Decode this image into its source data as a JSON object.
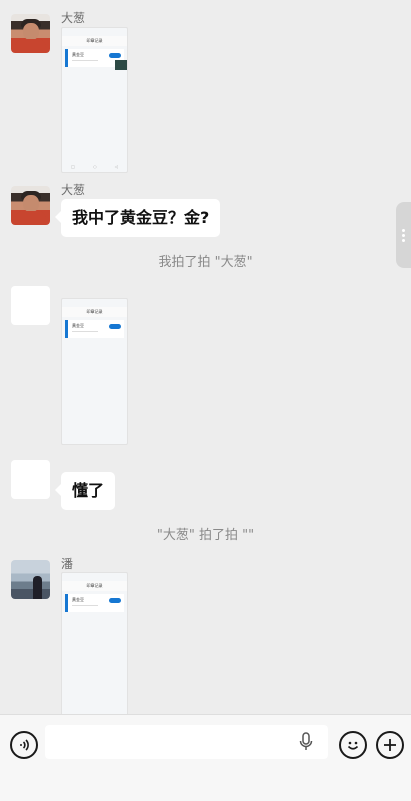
{
  "messages": {
    "sender1": "大葱",
    "sender2": "大葱",
    "bubble1": "我中了黄金豆？金?",
    "system1": "我拍了拍 \"大葱\"",
    "bubble2": "懂了",
    "system2": "\"大葱\" 拍了拍 \"\"",
    "sender3": "潘"
  },
  "thumb": {
    "header_title": "印章记录",
    "card_title": "黄金豆",
    "status_left": "7:49 ◎ 无法 …"
  },
  "input": {
    "placeholder": ""
  },
  "icons": {
    "voice": "voice-icon",
    "mic": "microphone-icon",
    "emoji": "emoji-icon",
    "plus": "plus-icon"
  }
}
